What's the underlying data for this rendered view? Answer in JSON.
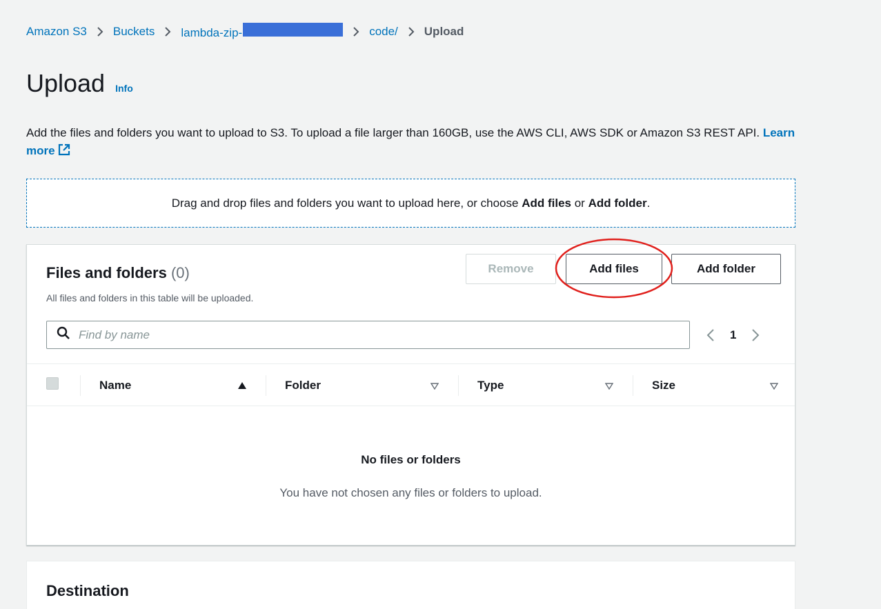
{
  "breadcrumb": {
    "items": [
      "Amazon S3",
      "Buckets",
      "lambda-zip-",
      "code/"
    ],
    "current": "Upload"
  },
  "header": {
    "title": "Upload",
    "info_label": "Info"
  },
  "description": {
    "text": "Add the files and folders you want to upload to S3. To upload a file larger than 160GB, use the AWS CLI, AWS SDK or Amazon S3 REST API.",
    "learn_more": "Learn more"
  },
  "dropzone": {
    "text_before": "Drag and drop files and folders you want to upload here, or choose",
    "add_files": "Add files",
    "or": "or",
    "add_folder": "Add folder",
    "end": "."
  },
  "files_panel": {
    "title": "Files and folders",
    "count": "(0)",
    "subtitle": "All files and folders in this table will be uploaded.",
    "remove_label": "Remove",
    "add_files_label": "Add files",
    "add_folder_label": "Add folder",
    "search_placeholder": "Find by name",
    "page": "1",
    "columns": [
      "Name",
      "Folder",
      "Type",
      "Size"
    ],
    "empty_title": "No files or folders",
    "empty_desc": "You have not chosen any files or folders to upload."
  },
  "destination": {
    "title": "Destination"
  },
  "colors": {
    "link": "#0073bb",
    "annotation": "#e0201c",
    "background": "#f2f3f3"
  }
}
